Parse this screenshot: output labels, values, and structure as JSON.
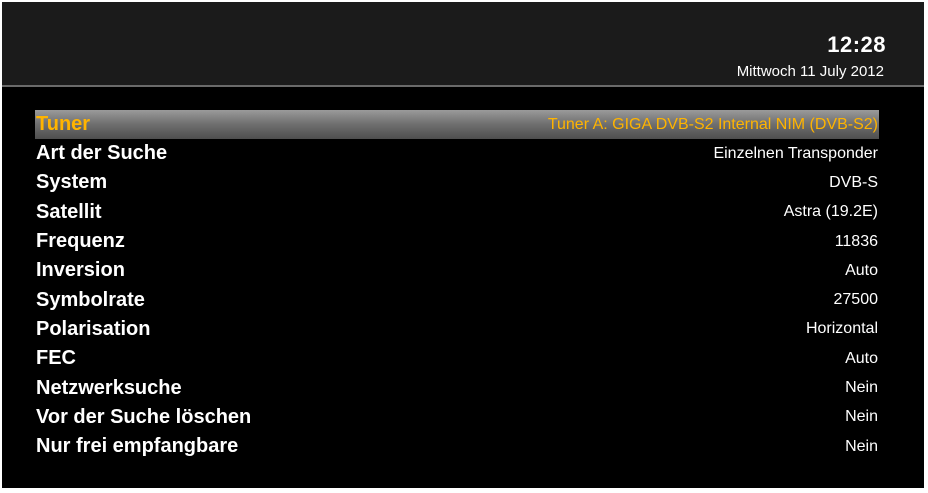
{
  "header": {
    "time": "12:28",
    "date": "Mittwoch 11 July 2012"
  },
  "colors": {
    "background": "#000000",
    "header_background": "#1b1b1b",
    "text": "#ffffff",
    "selected_text": "#ffb400"
  },
  "settings": {
    "items": [
      {
        "label": "Tuner",
        "value": "Tuner A: GIGA DVB-S2 Internal NIM (DVB-S2)",
        "selected": true
      },
      {
        "label": "Art der Suche",
        "value": "Einzelnen Transponder"
      },
      {
        "label": "System",
        "value": "DVB-S"
      },
      {
        "label": "Satellit",
        "value": "Astra (19.2E)"
      },
      {
        "label": "Frequenz",
        "value": "11836"
      },
      {
        "label": "Inversion",
        "value": "Auto"
      },
      {
        "label": "Symbolrate",
        "value": "27500"
      },
      {
        "label": "Polarisation",
        "value": "Horizontal"
      },
      {
        "label": "FEC",
        "value": "Auto"
      },
      {
        "label": "Netzwerksuche",
        "value": "Nein"
      },
      {
        "label": "Vor der Suche löschen",
        "value": "Nein"
      },
      {
        "label": "Nur frei empfangbare",
        "value": "Nein"
      }
    ]
  }
}
